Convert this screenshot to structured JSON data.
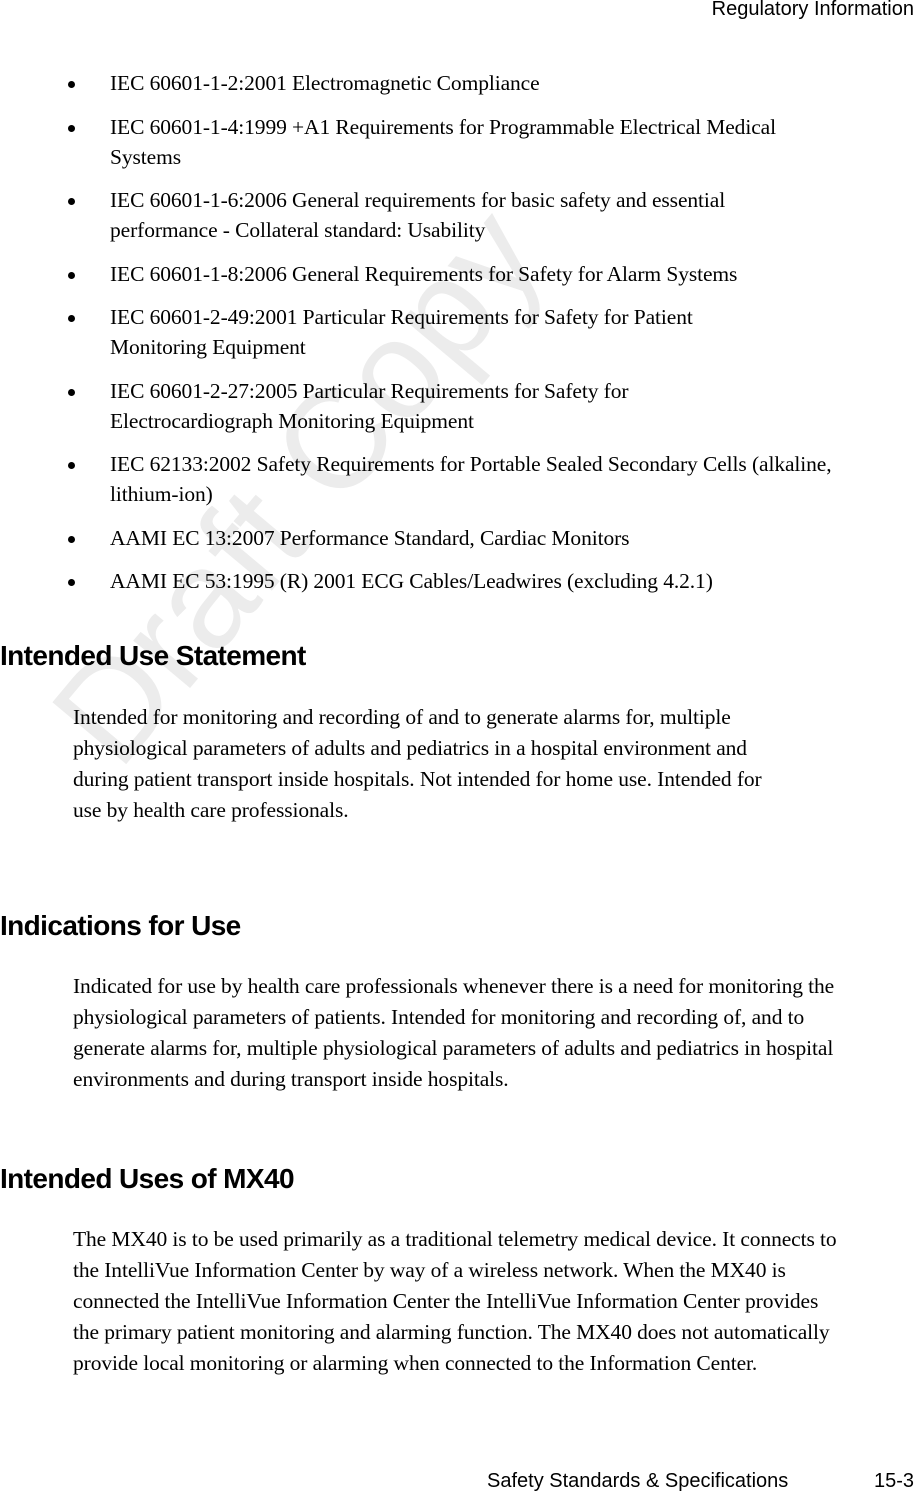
{
  "header": {
    "running_title": "Regulatory Information"
  },
  "watermark": {
    "text": "Draft Copy",
    "color": "#ececec"
  },
  "standards_list": [
    {
      "text": "IEC 60601-1-2:2001 Electromagnetic Compliance"
    },
    {
      "text": "IEC 60601-1-4:1999 +A1 Requirements for Programmable Electrical Medical Systems"
    },
    {
      "text": "IEC 60601-1-6:2006 General requirements for basic safety and essential performance - Collateral standard: Usability"
    },
    {
      "text": "IEC 60601-1-8:2006 General Requirements for Safety for Alarm Systems"
    },
    {
      "text": "IEC 60601-2-49:2001 Particular Requirements for Safety for Patient Monitoring Equipment"
    },
    {
      "text": "IEC 60601-2-27:2005 Particular Requirements for Safety for Electrocardiograph Monitoring Equipment"
    },
    {
      "text": "IEC 62133:2002 Safety Requirements for Portable Sealed Secondary Cells (alkaline, lithium-ion)"
    },
    {
      "text": "AAMI EC 13:2007 Performance Standard, Cardiac Monitors"
    },
    {
      "text": "AAMI EC 53:1995 (R) 2001 ECG Cables/Leadwires (excluding 4.2.1)"
    }
  ],
  "sections": [
    {
      "heading": "Intended Use Statement",
      "body": "Intended for monitoring and recording of and to generate alarms for, multiple physiological parameters of adults and pediatrics in a hospital environment and during patient transport inside hospitals. Not intended for home use. Intended for use by health care professionals."
    },
    {
      "heading": "Indications for Use",
      "body": "Indicated for use by health care professionals whenever there is a need for monitoring the physiological parameters of patients. Intended for monitoring and recording of, and to generate alarms for, multiple physiological parameters of adults and pediatrics in hospital environments and during transport inside hospitals."
    },
    {
      "heading": "Intended Uses of MX40",
      "body": "The MX40 is to be used primarily as a traditional telemetry medical device. It connects to the IntelliVue Information Center by way of a wireless network. When the MX40 is connected the IntelliVue Information Center the IntelliVue Information Center provides the primary patient monitoring and alarming function. The MX40 does not automatically provide local monitoring or alarming when connected to the Information Center."
    }
  ],
  "footer": {
    "section_title": "Safety Standards & Specifications",
    "page_number": "15-3"
  }
}
